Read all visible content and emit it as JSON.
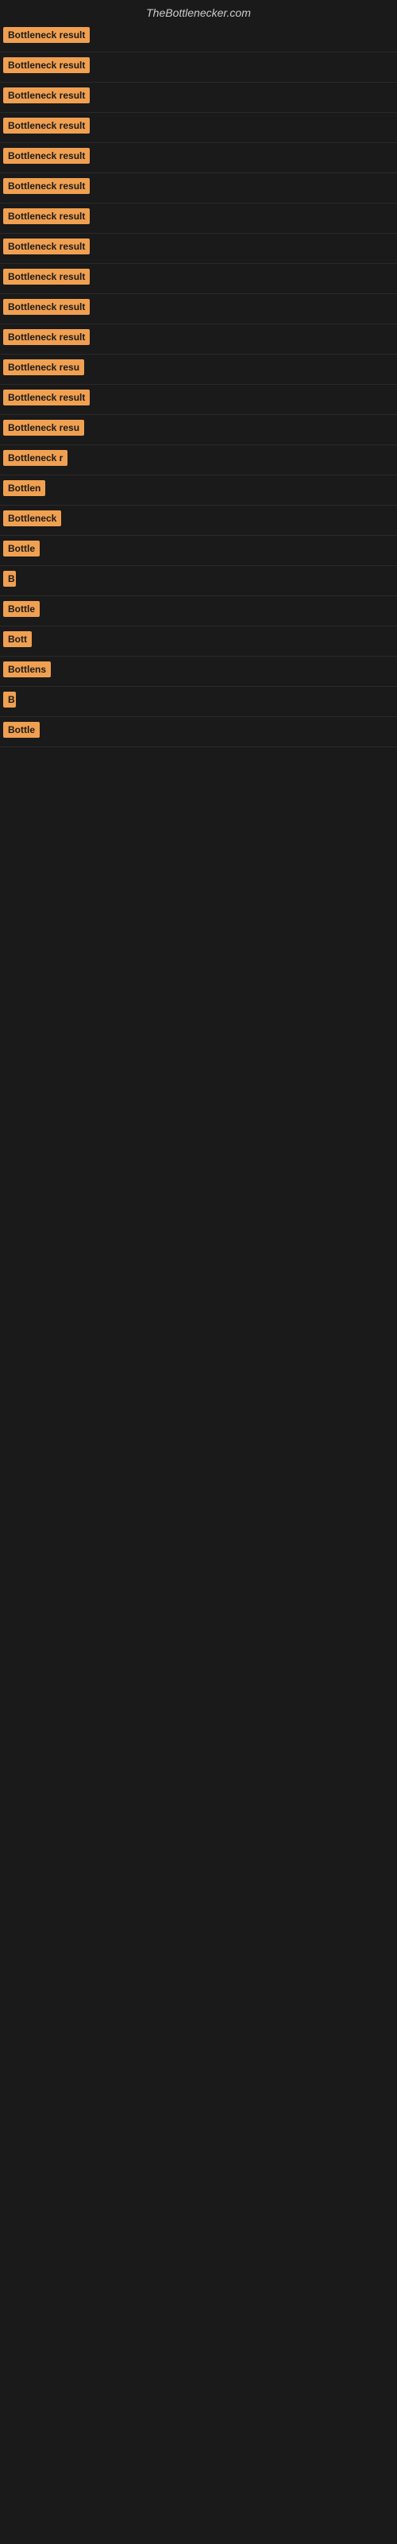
{
  "site": {
    "title": "TheBottlenecker.com"
  },
  "rows": [
    {
      "label": "Bottleneck result",
      "width": 120
    },
    {
      "label": "Bottleneck result",
      "width": 120
    },
    {
      "label": "Bottleneck result",
      "width": 120
    },
    {
      "label": "Bottleneck result",
      "width": 120
    },
    {
      "label": "Bottleneck result",
      "width": 120
    },
    {
      "label": "Bottleneck result",
      "width": 120
    },
    {
      "label": "Bottleneck result",
      "width": 120
    },
    {
      "label": "Bottleneck result",
      "width": 120
    },
    {
      "label": "Bottleneck result",
      "width": 120
    },
    {
      "label": "Bottleneck result",
      "width": 120
    },
    {
      "label": "Bottleneck result",
      "width": 120
    },
    {
      "label": "Bottleneck resu",
      "width": 108
    },
    {
      "label": "Bottleneck result",
      "width": 120
    },
    {
      "label": "Bottleneck resu",
      "width": 108
    },
    {
      "label": "Bottleneck r",
      "width": 84
    },
    {
      "label": "Bottlen",
      "width": 60
    },
    {
      "label": "Bottleneck",
      "width": 76
    },
    {
      "label": "Bottle",
      "width": 52
    },
    {
      "label": "B",
      "width": 16
    },
    {
      "label": "Bottle",
      "width": 52
    },
    {
      "label": "Bott",
      "width": 36
    },
    {
      "label": "Bottlens",
      "width": 64
    },
    {
      "label": "B",
      "width": 16
    },
    {
      "label": "Bottle",
      "width": 52
    }
  ]
}
